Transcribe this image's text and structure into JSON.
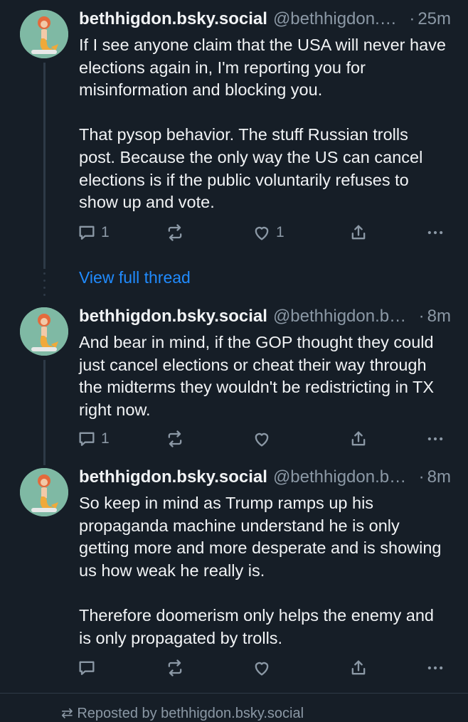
{
  "colors": {
    "background": "#161e27",
    "text": "#f1f3f5",
    "muted": "#8b98a5",
    "link": "#208bfe",
    "thread_line": "#2e3a47"
  },
  "posts": [
    {
      "name": "bethhigdon.bsky.social",
      "handle": "@bethhigdon.bsky.social",
      "time": "25m",
      "text": "If I see anyone claim that the USA will never have elections again in, I'm reporting you for misinformation and blocking you.\n\nThat pysop behavior. The stuff Russian trolls post. Because the only way the US can cancel elections is if the public voluntarily refuses to show up and vote.",
      "reply_count": "1",
      "repost_count": "",
      "like_count": "1"
    },
    {
      "name": "bethhigdon.bsky.social",
      "handle": "@bethhigdon.bsky.social",
      "time": "8m",
      "text": "And bear in mind, if the GOP thought they could just cancel elections or cheat their way through the midterms they wouldn't be redistricting in TX right now.",
      "reply_count": "1",
      "repost_count": "",
      "like_count": ""
    },
    {
      "name": "bethhigdon.bsky.social",
      "handle": "@bethhigdon.bsky.social",
      "time": "8m",
      "text": "So keep in mind as Trump ramps up his propaganda machine understand he is only getting more and more desperate and is showing us how weak he really is.\n\nTherefore doomerism only helps the enemy and is only propagated by trolls.",
      "reply_count": "",
      "repost_count": "",
      "like_count": ""
    }
  ],
  "thread": {
    "view_full_thread": "View full thread"
  },
  "repost_banner": "Reposted by bethhigdon.bsky.social",
  "icons": {
    "reply": "reply-icon",
    "repost": "repost-icon",
    "like": "heart-icon",
    "share": "share-icon",
    "more": "more-icon"
  },
  "separator": "·"
}
